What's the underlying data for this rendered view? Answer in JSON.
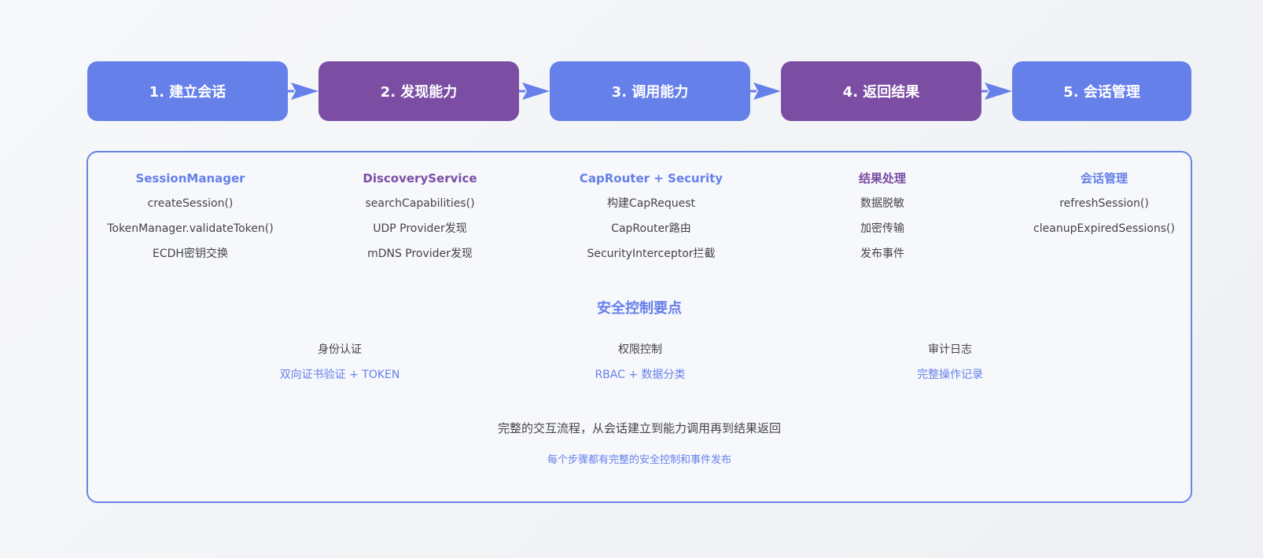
{
  "steps": [
    {
      "label": "1. 建立会话",
      "color": "#6680ea"
    },
    {
      "label": "2. 发现能力",
      "color": "#7b4ea4"
    },
    {
      "label": "3. 调用能力",
      "color": "#6680ea"
    },
    {
      "label": "4. 返回结果",
      "color": "#7b4ea4"
    },
    {
      "label": "5. 会话管理",
      "color": "#6680ea"
    }
  ],
  "columns": [
    {
      "title": "SessionManager",
      "items": [
        "createSession()",
        "TokenManager.validateToken()",
        "ECDH密钥交换"
      ]
    },
    {
      "title": "DiscoveryService",
      "items": [
        "searchCapabilities()",
        "UDP Provider发现",
        "mDNS Provider发现"
      ]
    },
    {
      "title": "CapRouter + Security",
      "items": [
        "构建CapRequest",
        "CapRouter路由",
        "SecurityInterceptor拦截"
      ]
    },
    {
      "title": "结果处理",
      "items": [
        "数据脱敏",
        "加密传输",
        "发布事件"
      ]
    },
    {
      "title": "会话管理",
      "items": [
        "refreshSession()",
        "cleanupExpiredSessions()"
      ]
    }
  ],
  "security": {
    "title": "安全控制要点",
    "points": [
      {
        "name": "身份认证",
        "desc": "双向证书验证 + TOKEN"
      },
      {
        "name": "权限控制",
        "desc": "RBAC + 数据分类"
      },
      {
        "name": "审计日志",
        "desc": "完整操作记录"
      }
    ]
  },
  "summary": {
    "main": "完整的交互流程，从会话建立到能力调用再到结果返回",
    "sub": "每个步骤都有完整的安全控制和事件发布"
  },
  "colors": {
    "blue": "#6680ea",
    "purple": "#7b4ea4",
    "border": "#6a82e6"
  }
}
